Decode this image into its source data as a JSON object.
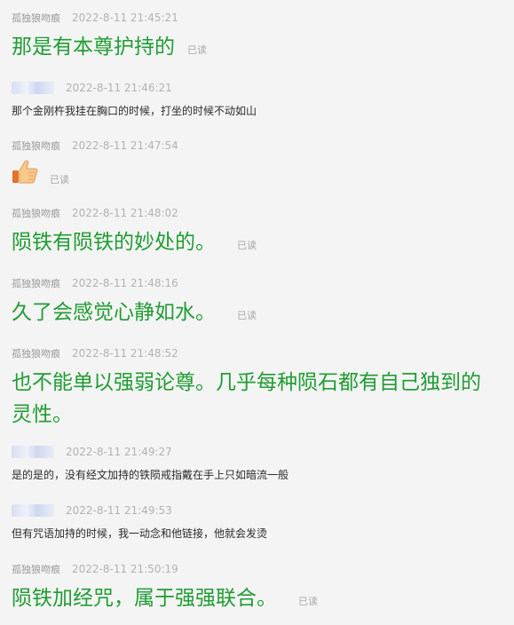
{
  "messages": [
    {
      "sender": "孤独狼吻痕",
      "time": "2022-8-11 21:45:21",
      "text": "那是有本尊护持的",
      "read": "已读"
    },
    {
      "sender": "",
      "time": "2022-8-11 21:46:21",
      "text": "那个金刚杵我挂在胸口的时候，打坐的时候不动如山"
    },
    {
      "sender": "孤独狼吻痕",
      "time": "2022-8-11 21:47:54",
      "icon": "thumbs-up-emoji",
      "read": "已读"
    },
    {
      "sender": "孤独狼吻痕",
      "time": "2022-8-11 21:48:02",
      "text": "陨铁有陨铁的妙处的。",
      "read": "已读"
    },
    {
      "sender": "孤独狼吻痕",
      "time": "2022-8-11 21:48:16",
      "text": "久了会感觉心静如水。",
      "read": "已读"
    },
    {
      "sender": "孤独狼吻痕",
      "time": "2022-8-11 21:48:52",
      "text_line1": "也不能单以强弱论尊。几乎每种陨石都有自己独到的",
      "text_line2": "灵性。"
    },
    {
      "sender": "",
      "time": "2022-8-11 21:49:27",
      "text": "是的是的，没有经文加持的铁陨戒指戴在手上只如暗流一般"
    },
    {
      "sender": "",
      "time": "2022-8-11 21:49:53",
      "text": "但有咒语加持的时候，我一动念和他链接，他就会发烫"
    },
    {
      "sender": "孤独狼吻痕",
      "time": "2022-8-11 21:50:19",
      "text": "陨铁加经咒，属于强强联合。",
      "read": "已读"
    }
  ]
}
